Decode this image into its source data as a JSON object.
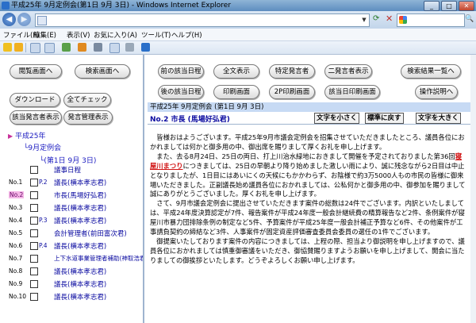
{
  "window": {
    "title": "平成25年 9月定例会(第1日 9月 3日) - Windows Internet Explorer"
  },
  "menu": [
    "ファイル(F)",
    "編集(E)",
    "表示(V)",
    "お気に入り(A)",
    "ツール(T)",
    "ヘルプ(H)"
  ],
  "left": {
    "buttons": {
      "prev_screen": "閲覧画面へ",
      "search_screen": "検索画面へ",
      "download": "ダウンロード",
      "check_all": "全てチェック",
      "show_speakers": "該当発言者表示",
      "show_all_speakers": "発言管理表示"
    },
    "tree": {
      "root": "平成25年",
      "session": "9月定例会",
      "day": "(第1日 9月 3日)"
    },
    "rows": [
      {
        "no": "",
        "pg": "",
        "speaker": "議事日程"
      },
      {
        "no": "No.1",
        "pg": "P.2",
        "speaker": "議長(横本孝志君)"
      },
      {
        "no": "No.2",
        "pg": "",
        "speaker": "市長(馬場好弘君)"
      },
      {
        "no": "No.3",
        "pg": "",
        "speaker": "議長(横本孝志君)"
      },
      {
        "no": "No.4",
        "pg": "P.3",
        "speaker": "議長(横本孝志君)"
      },
      {
        "no": "No.5",
        "pg": "",
        "speaker": "会計管理者(前田富次君)"
      },
      {
        "no": "No.6",
        "pg": "P.4",
        "speaker": "議長(横本孝志君)"
      },
      {
        "no": "No.7",
        "pg": "",
        "speaker": "上下水道事業管理者補助(神取浩君)"
      },
      {
        "no": "No.8",
        "pg": "",
        "speaker": "議長(横本孝志君)"
      },
      {
        "no": "No.9",
        "pg": "",
        "speaker": "議長(横本孝志君)"
      },
      {
        "no": "No.10",
        "pg": "",
        "speaker": "議長(横本孝志君)"
      }
    ]
  },
  "right": {
    "buttons": {
      "prev_date": "前の該当日程",
      "full_text": "全文表示",
      "specific_speaker": "特定発言者",
      "two_speakers": "二発言者表示",
      "results_list": "検索結果一覧へ",
      "next_date": "後の該当日程",
      "print_screen": "印刷画面",
      "pdf_print": "2P印刷画面",
      "date_print": "該当日印刷画面",
      "help": "操作説明へ"
    },
    "meeting_header": "平成25年 9月定例会 (第1日 9月 3日)",
    "speaker": "No.2 市長 (馬場好弘君)",
    "font_buttons": {
      "smaller": "文字を小さく",
      "standard": "標準に戻す",
      "larger": "文字を大きく"
    },
    "paragraphs": [
      {
        "before": "皆様おはようございます。平成25年9月市議会定例会を招集させていただきましたところ、議員各位におかれましては何かと御多用の中、御出席を賜りまして厚くお礼を申し上げます。",
        "highlight": "",
        "after": ""
      },
      {
        "before": "また、去る8月24日、25日の両日、打上川治水緑地におきまして開催を予定されておりました第36回",
        "highlight": "寝屋川まつり",
        "after": "につきましては、25日の早朝より降り始めました激しい雨により、誠に残念ながら2日目は中止となりましたが、1日目にはあいにくの天候にもかかわらず、お陰様で約3万5000人もの市民の皆様に御来場いただきました。正副議長始め議員各位におかれましては、公私何かと御多用の中、御参加を賜りまして誠にありがとうございました。厚くお礼を申し上げます。"
      },
      {
        "before": "さて、9月市議会定例会に提出させていただきます案件の総数は24件でございます。内訳といたしましては、平成24年度決算認定が7件、報告案件が平成24年度一般会計継続費の精算報告など2件、条例案件が寝屋川市暴力団排除条例の制定など5件、予算案件が平成25年度一般会計補正予算など6件、その他案件が工事請負契約の締結など3件、人事案件が固定資産評価審査委員会委員の選任の1件でございます。",
        "highlight": "",
        "after": ""
      },
      {
        "before": "御提案いたしております案件の内容につきましては、上程の際、担当より御説明を申し上げますので、議員各位におかれましては慎重御審議をいただき、御協賛賜りますようお願いを申し上げまして、開会に当たりましての御挨拶といたします。どうぞよろしくお願い申し上げます。",
        "highlight": "",
        "after": ""
      }
    ]
  }
}
